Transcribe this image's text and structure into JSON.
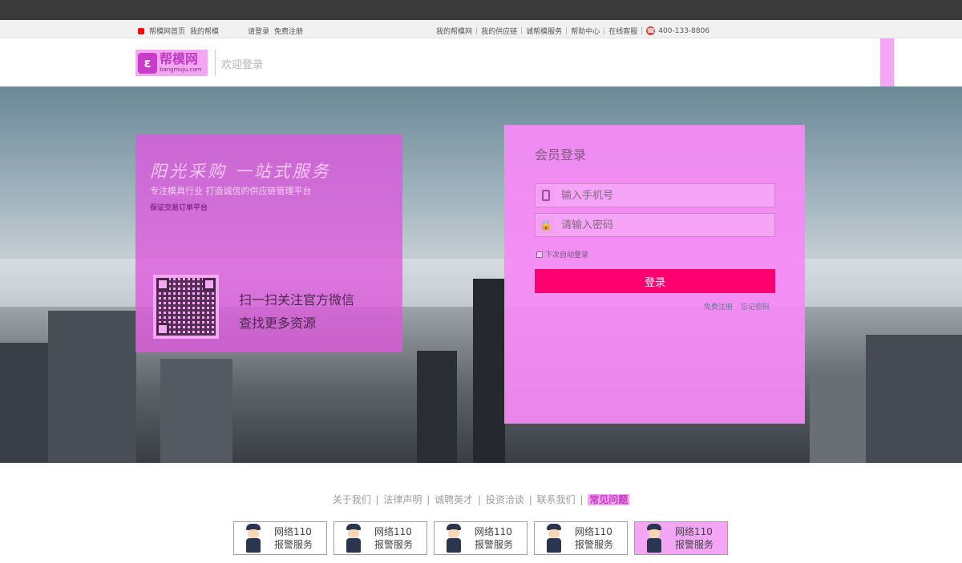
{
  "topbar": {
    "left_items": [
      "帮模网首页",
      "我的帮模",
      "请登录",
      "免费注册"
    ],
    "right_items": [
      "我的帮模网",
      "我的供应链",
      "诚帮模服务",
      "帮助中心",
      "在线客服"
    ],
    "phone": "400-133-8806"
  },
  "header": {
    "logo_cn": "帮模网",
    "logo_en": "bangmuju.com",
    "welcome": "欢迎登录"
  },
  "promo": {
    "title": "阳光采购  一站式服务",
    "subtitle": "专注模具行业    打造诚信的供应链管理平台",
    "tagline": "保证交易订单平台",
    "qr_line1": "扫一扫关注官方微信",
    "qr_line2": "查找更多资源"
  },
  "login": {
    "title": "会员登录",
    "phone_placeholder": "输入手机号",
    "password_placeholder": "请输入密码",
    "remember": "下次自动登录",
    "submit": "登录",
    "register": "免费注册",
    "forgot": "忘记密码"
  },
  "footer": {
    "links": [
      "关于我们",
      "法律声明",
      "诚聘英才",
      "投资洽谈",
      "联系我们"
    ],
    "faq": "常见问题",
    "badges": [
      {
        "line1": "网络110",
        "line2": "报警服务"
      },
      {
        "line1": "网络110",
        "line2": "报警服务"
      },
      {
        "line1": "网络110",
        "line2": "报警服务"
      },
      {
        "line1": "网络110",
        "line2": "报警服务"
      },
      {
        "line1": "网络110",
        "line2": "报警服务"
      }
    ]
  },
  "colors": {
    "accent": "#ff0800",
    "button": "#fe0000",
    "link": "#647994",
    "muted": "#b3b3b3",
    "footer_text": "#9c9c9c",
    "badge_border": "#9f9f9f"
  }
}
